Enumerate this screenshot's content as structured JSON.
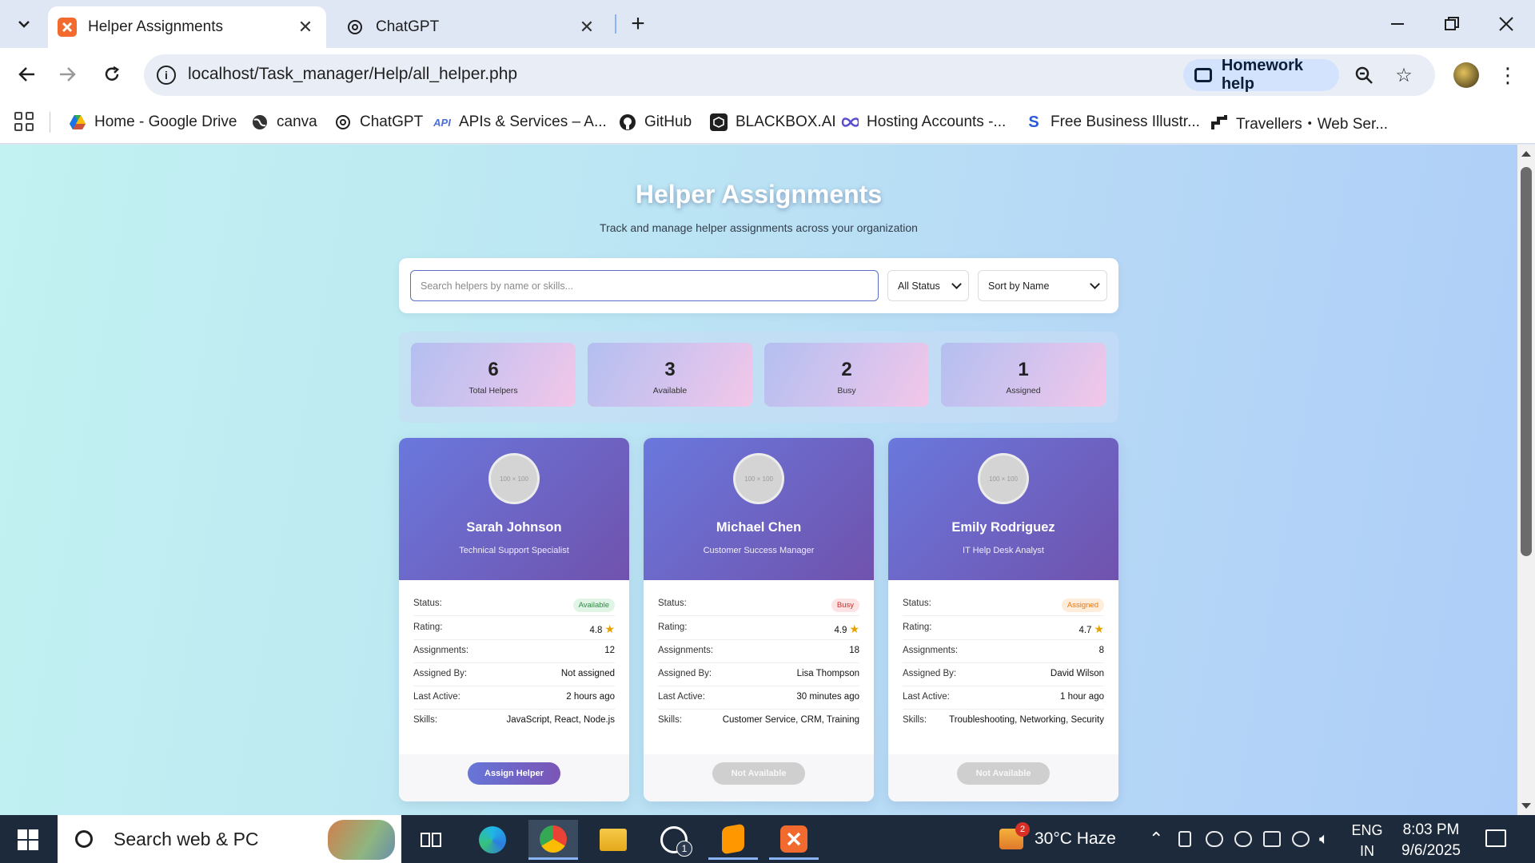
{
  "browser": {
    "tabs": [
      {
        "title": "Helper Assignments",
        "active": true
      },
      {
        "title": "ChatGPT",
        "active": false
      }
    ],
    "url": "localhost/Task_manager/Help/all_helper.php",
    "homework_help": "Homework help",
    "bookmarks": [
      {
        "label": "Home - Google Drive",
        "icon": "google-drive-icon"
      },
      {
        "label": "canva",
        "icon": "globe-icon"
      },
      {
        "label": "ChatGPT",
        "icon": "chatgpt-icon"
      },
      {
        "label": "APIs & Services – A...",
        "icon": "api-icon",
        "icon_text": "API"
      },
      {
        "label": "GitHub",
        "icon": "github-icon"
      },
      {
        "label": "BLACKBOX.AI",
        "icon": "blackbox-icon"
      },
      {
        "label": "Hosting Accounts -...",
        "icon": "infinity-icon"
      },
      {
        "label": "Free Business Illustr...",
        "icon": "s-logo-icon",
        "icon_text": "S"
      },
      {
        "label": "Travellers・Web Ser...",
        "icon": "travellers-icon"
      }
    ]
  },
  "page": {
    "title": "Helper Assignments",
    "subtitle": "Track and manage helper assignments across your organization",
    "search_placeholder": "Search helpers by name or skills...",
    "status_filter": "All Status",
    "sort_filter": "Sort by Name",
    "stats": [
      {
        "value": "6",
        "label": "Total Helpers"
      },
      {
        "value": "3",
        "label": "Available"
      },
      {
        "value": "2",
        "label": "Busy"
      },
      {
        "value": "1",
        "label": "Assigned"
      }
    ],
    "field_labels": {
      "status": "Status:",
      "rating": "Rating:",
      "assignments": "Assignments:",
      "assigned_by": "Assigned By:",
      "last_active": "Last Active:",
      "skills": "Skills:"
    },
    "avatar_placeholder": "100 × 100",
    "helpers": [
      {
        "name": "Sarah Johnson",
        "role": "Technical Support Specialist",
        "status": "Available",
        "status_color": "#2f8a45",
        "rating": "4.8",
        "assignments": "12",
        "assigned_by": "Not assigned",
        "last_active": "2 hours ago",
        "skills": "JavaScript, React, Node.js",
        "action": "Assign Helper"
      },
      {
        "name": "Michael Chen",
        "role": "Customer Success Manager",
        "status": "Busy",
        "status_color": "#c9302c",
        "rating": "4.9",
        "assignments": "18",
        "assigned_by": "Lisa Thompson",
        "last_active": "30 minutes ago",
        "skills": "Customer Service, CRM, Training",
        "action": "Not Available"
      },
      {
        "name": "Emily Rodriguez",
        "role": "IT Help Desk Analyst",
        "status": "Assigned",
        "status_color": "#e67712",
        "rating": "4.7",
        "assignments": "8",
        "assigned_by": "David Wilson",
        "last_active": "1 hour ago",
        "skills": "Troubleshooting, Networking, Security",
        "action": "Not Available"
      }
    ]
  },
  "taskbar": {
    "search_text": "Search web & PC",
    "weather": "30°C  Haze",
    "weather_badge": "2",
    "whatsapp_badge": "1",
    "lang_line1": "ENG",
    "lang_line2": "IN",
    "time": "8:03 PM",
    "date": "9/6/2025"
  },
  "colors": {
    "accent": "#6a78dd",
    "accent_dark": "#7052ad"
  }
}
